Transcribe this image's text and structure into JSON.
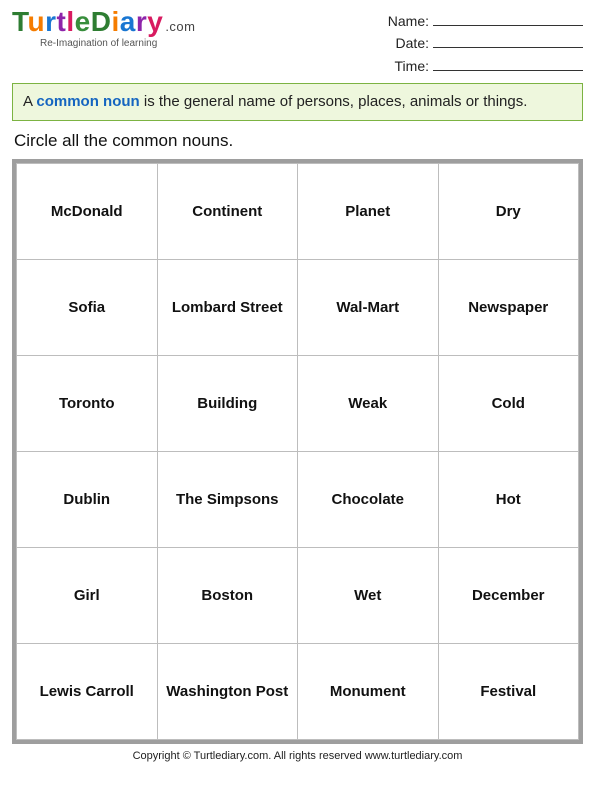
{
  "logo": {
    "word": "TurtleDiary",
    "suffix": ".com",
    "tagline": "Re-Imagination of learning"
  },
  "meta": {
    "name_label": "Name:",
    "date_label": "Date:",
    "time_label": "Time:"
  },
  "definition": {
    "prefix": "A ",
    "keyword": "common noun",
    "rest": " is the general name of persons, places, animals or things."
  },
  "instruction": "Circle all the common nouns.",
  "grid": [
    [
      "McDonald",
      "Continent",
      "Planet",
      "Dry"
    ],
    [
      "Sofia",
      "Lombard Street",
      "Wal-Mart",
      "Newspaper"
    ],
    [
      "Toronto",
      "Building",
      "Weak",
      "Cold"
    ],
    [
      "Dublin",
      "The Simpsons",
      "Chocolate",
      "Hot"
    ],
    [
      "Girl",
      "Boston",
      "Wet",
      "December"
    ],
    [
      "Lewis Carroll",
      "Washington Post",
      "Monument",
      "Festival"
    ]
  ],
  "footer": "Copyright © Turtlediary.com. All rights reserved  www.turtlediary.com"
}
